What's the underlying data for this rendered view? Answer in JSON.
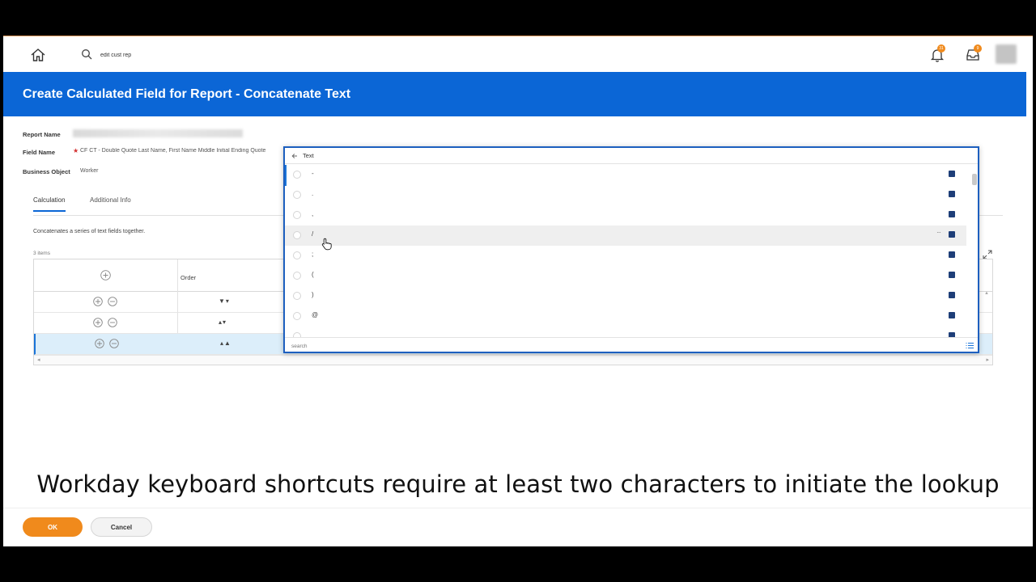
{
  "topnav": {
    "search_value": "edit cust rep",
    "notifications_count": "31",
    "inbox_count": "9"
  },
  "header": {
    "title": "Create Calculated Field for Report - Concatenate Text"
  },
  "form": {
    "report_name_label": "Report Name",
    "field_name_label": "Field Name",
    "field_name_value": "CF CT - Double Quote Last Name, First Name Middle Initial Ending Quote",
    "business_object_label": "Business Object",
    "business_object_value": "Worker"
  },
  "tabs": [
    {
      "label": "Calculation"
    },
    {
      "label": "Additional Info"
    }
  ],
  "calculation": {
    "description": "Concatenates a series of text fields together.",
    "items_count": "3 items",
    "order_header": "Order",
    "rows": [
      {
        "order": "▼▾"
      },
      {
        "order": "▴▾"
      },
      {
        "order": "▴▲"
      }
    ]
  },
  "prompt": {
    "title": "Text",
    "search_placeholder": "search",
    "options": [
      {
        "label": "-"
      },
      {
        "label": "."
      },
      {
        "label": ","
      },
      {
        "label": "/"
      },
      {
        "label": ";"
      },
      {
        "label": "("
      },
      {
        "label": ")"
      },
      {
        "label": "@"
      }
    ]
  },
  "caption": "Workday keyboard shortcuts require at least two characters to initiate the lookup",
  "footer": {
    "ok_label": "OK",
    "cancel_label": "Cancel"
  },
  "colors": {
    "header_blue": "#0b66d6",
    "accent_orange": "#f08a1c",
    "prompt_border": "#1d5fbf",
    "badge_navy": "#1e3e78"
  }
}
